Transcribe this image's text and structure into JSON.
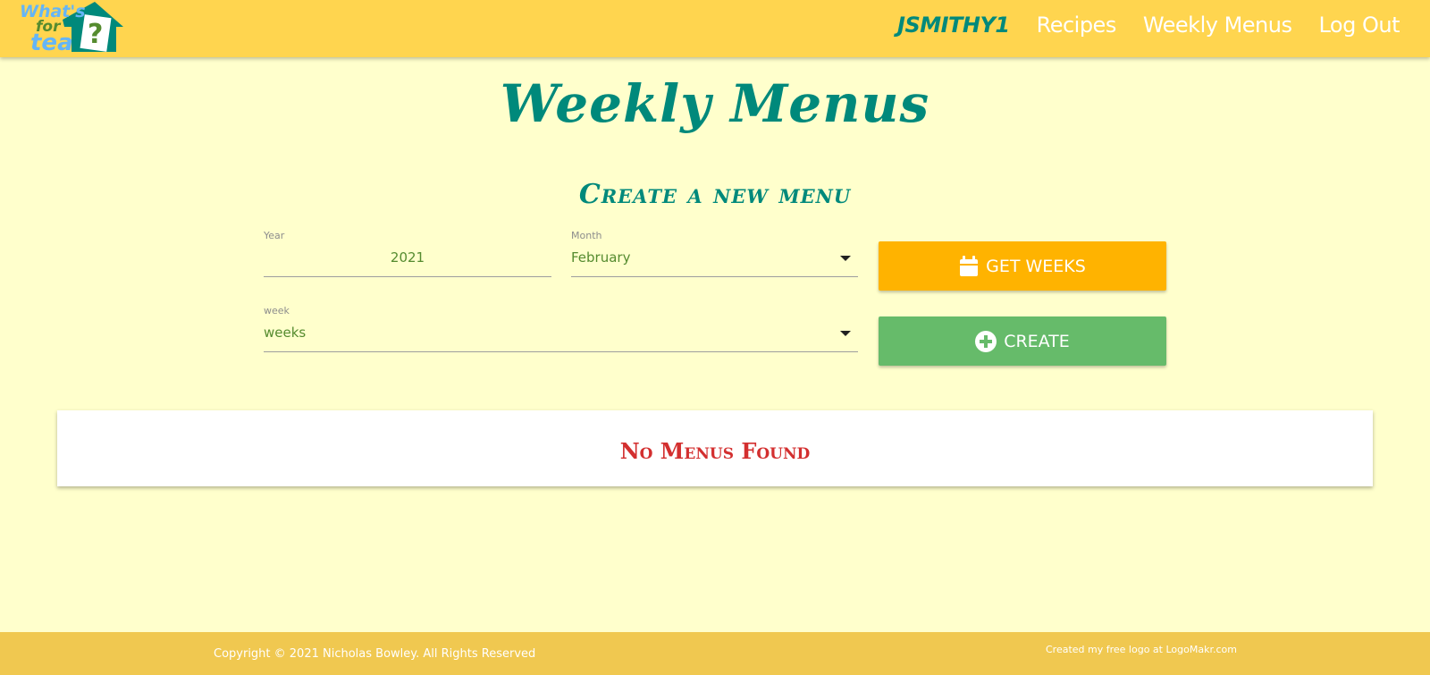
{
  "header": {
    "logo": {
      "line1": "What's",
      "line2": "for",
      "line3": "tea",
      "icon": "house-question-icon"
    },
    "nav": [
      {
        "label": "JSMITHY1"
      },
      {
        "label": "Recipes"
      },
      {
        "label": "Weekly Menus"
      },
      {
        "label": "Log Out"
      }
    ]
  },
  "page": {
    "title": "Weekly Menus",
    "section_title": "Create a new menu"
  },
  "form": {
    "year": {
      "label": "Year",
      "value": "2021"
    },
    "month": {
      "label": "Month",
      "value": "February"
    },
    "week": {
      "label": "week",
      "value": "weeks"
    },
    "get_weeks_label": "GET WEEKS",
    "get_weeks_icon": "calendar-icon",
    "create_label": "CREATE",
    "create_icon": "plus-circle-icon"
  },
  "menus": {
    "empty_message": "No Menus Found"
  },
  "footer": {
    "copyright": "Copyright © 2021 Nicholas Bowley. All Rights Reserved",
    "credit": "Created my free logo at LogoMakr.com"
  },
  "colors": {
    "header_bg": "#ffd54f",
    "page_bg": "#ffffcc",
    "accent_teal": "#00897b",
    "get_weeks_bg": "#ffb300",
    "create_bg": "#66bb6a",
    "empty_text": "#d32f2f",
    "footer_bg": "#f0c850"
  }
}
